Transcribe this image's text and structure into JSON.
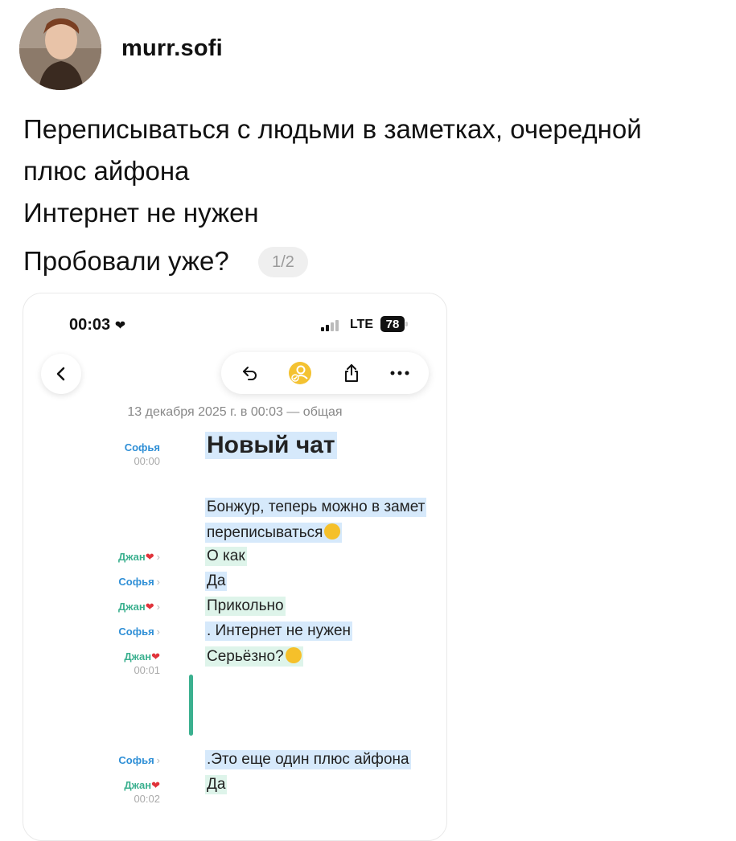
{
  "post": {
    "username": "murr.sofi",
    "lines": [
      "Переписываться с людьми в заметках, очередной",
      "плюс айфона",
      "Интернет не нужен",
      "Пробовали уже?"
    ],
    "image_counter": "1/2"
  },
  "phone": {
    "status_time": "00:03",
    "network": "LTE",
    "battery": "78",
    "note_meta": "13 декабря 2025 г. в 00:03 — общая",
    "title_author": "Софья",
    "title_time": "00:00",
    "title": "Новый чат",
    "messages": [
      {
        "author": "",
        "time": "",
        "text": "Бонжур, теперь можно в замет"
      },
      {
        "author": "",
        "time": "",
        "text": "переписываться"
      },
      {
        "author": "Джан",
        "time": "",
        "text": "О как"
      },
      {
        "author": "Софья",
        "time": "",
        "text": "Да"
      },
      {
        "author": "Джан",
        "time": "",
        "text": "Прикольно"
      },
      {
        "author": "Софья",
        "time": "",
        "text": ". Интернет не нужен"
      },
      {
        "author": "Джан",
        "time": "00:01",
        "text": "Серьёзно?"
      },
      {
        "author": "Софья",
        "time": "",
        "text": ".Это еще один плюс айфона"
      },
      {
        "author": "Джан",
        "time": "00:02",
        "text": "Да"
      }
    ]
  },
  "colors": {
    "sofya": "#2f8fd6",
    "jan": "#3bb08f",
    "highlight_blue": "#d6e9fb",
    "highlight_green": "#def4ea"
  },
  "icons": [
    "back-chevron-icon",
    "undo-icon",
    "collaborate-icon",
    "share-icon",
    "more-icon",
    "heart-icon",
    "laughing-emoji",
    "flushed-emoji"
  ]
}
